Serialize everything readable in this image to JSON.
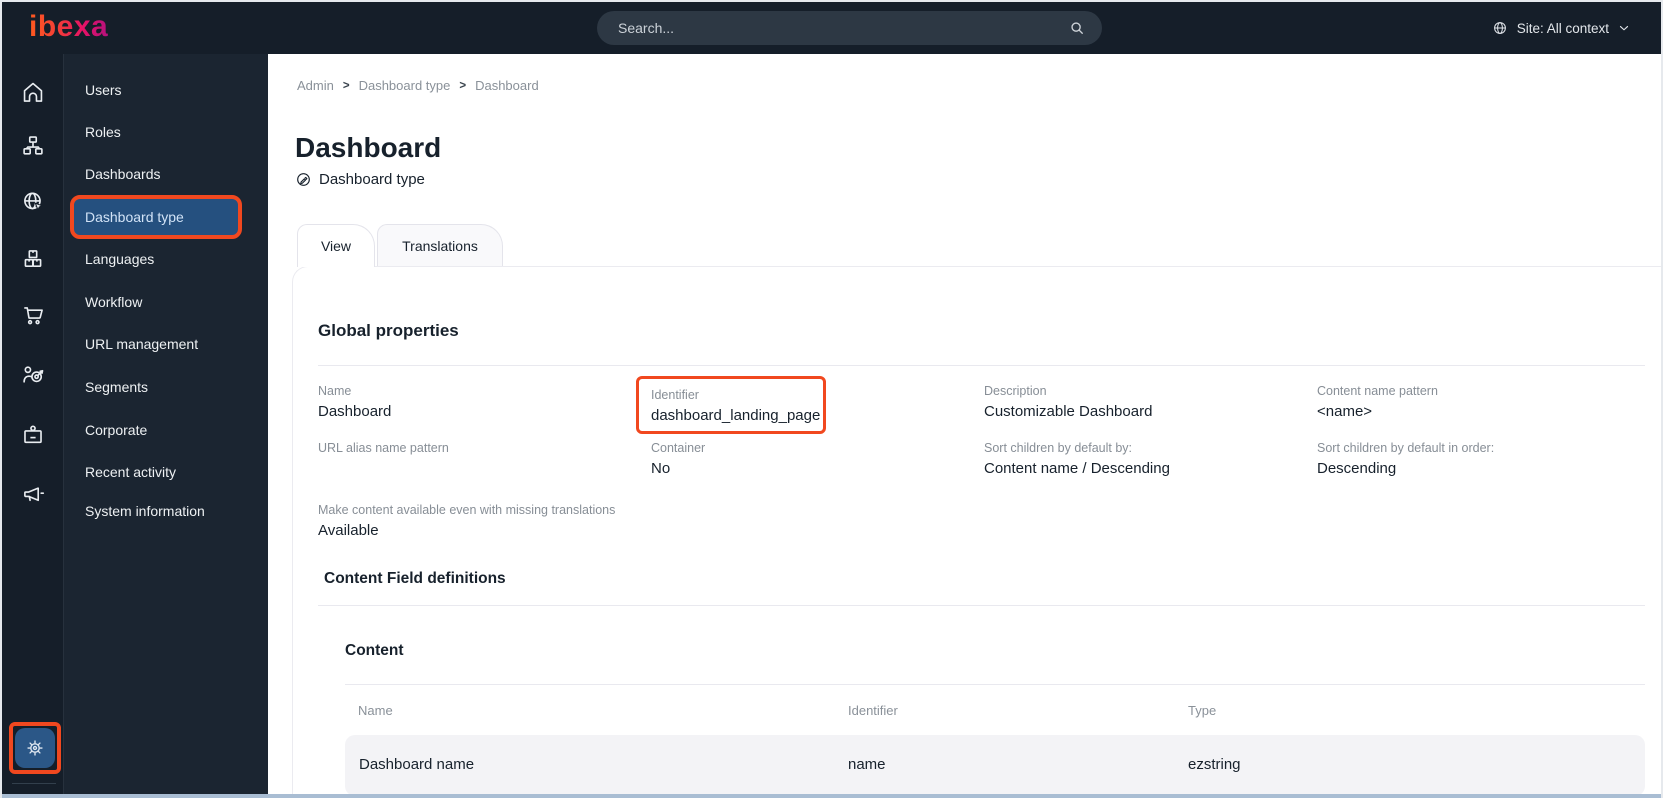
{
  "topbar": {
    "logo_text": "ibexa",
    "search_placeholder": "Search...",
    "site_selector_label": "Site: All context"
  },
  "sidebar": {
    "rail_icons": [
      "home-icon",
      "content-tree-icon",
      "site-globe-icon",
      "products-boxes-icon",
      "commerce-cart-icon",
      "audience-target-icon",
      "corporate-badge-icon",
      "megaphone-icon"
    ],
    "settings_icon": "settings-gear-icon",
    "menu_items": [
      {
        "label": "Users",
        "active": false
      },
      {
        "label": "Roles",
        "active": false
      },
      {
        "label": "Dashboards",
        "active": false
      },
      {
        "label": "Dashboard type",
        "active": true
      },
      {
        "label": "Languages",
        "active": false
      },
      {
        "label": "Workflow",
        "active": false
      },
      {
        "label": "URL management",
        "active": false
      },
      {
        "label": "Segments",
        "active": false
      },
      {
        "label": "Corporate",
        "active": false
      },
      {
        "label": "Recent activity",
        "active": false
      },
      {
        "label": "System information",
        "active": false
      }
    ]
  },
  "breadcrumb": {
    "items": [
      "Admin",
      "Dashboard type",
      "Dashboard"
    ],
    "separator": ">"
  },
  "page": {
    "title": "Dashboard",
    "content_type_label": "Dashboard type"
  },
  "tabs": [
    {
      "label": "View",
      "active": true
    },
    {
      "label": "Translations",
      "active": false
    }
  ],
  "global_properties": {
    "heading": "Global properties",
    "fields": [
      {
        "label": "Name",
        "value": "Dashboard"
      },
      {
        "label": "Identifier",
        "value": "dashboard_landing_page",
        "highlighted": true
      },
      {
        "label": "Description",
        "value": "Customizable Dashboard"
      },
      {
        "label": "Content name pattern",
        "value": "<name>"
      },
      {
        "label": "URL alias name pattern",
        "value": ""
      },
      {
        "label": "Container",
        "value": "No"
      },
      {
        "label": "Sort children by default by:",
        "value": "Content name / Descending"
      },
      {
        "label": "Sort children by default in order:",
        "value": "Descending"
      },
      {
        "label": "Make content available even with missing translations",
        "value": "Available"
      }
    ]
  },
  "field_definitions": {
    "heading": "Content Field definitions",
    "group_heading": "Content",
    "table": {
      "headers": [
        "Name",
        "Identifier",
        "Type"
      ],
      "rows": [
        {
          "name": "Dashboard name",
          "identifier": "name",
          "type": "ezstring"
        }
      ]
    }
  },
  "colors": {
    "accent_orange": "#f1481f",
    "active_item_blue": "#25507f",
    "topbar_bg": "#151e29",
    "menu_bg": "#1b2531",
    "row_bg": "#f3f3f6"
  }
}
